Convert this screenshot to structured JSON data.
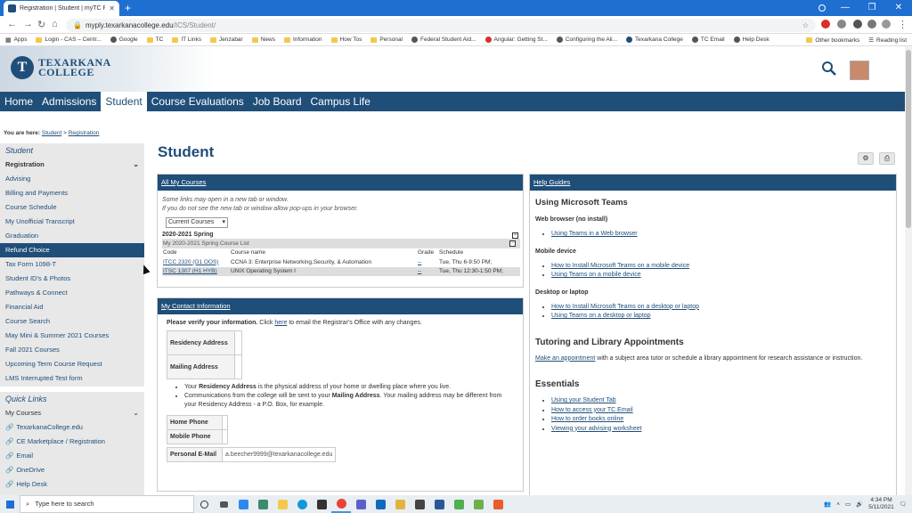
{
  "browser": {
    "tab_title": "Registration | Student | myTC Po",
    "url_host": "myply.texarkanacollege.edu",
    "url_path": "/ICS/Student/",
    "bookmarks": [
      "Apps",
      "Login - CAS – Centr...",
      "Google",
      "TC",
      "IT Links",
      "Jenzabar",
      "News",
      "Information",
      "How Tos",
      "Personal",
      "Federal Student Aid...",
      "Angular: Getting St...",
      "Configuring the Ali...",
      "Texarkana College",
      "TC Email",
      "Help Desk"
    ],
    "bookmarks_right": [
      "Other bookmarks",
      "Reading list"
    ]
  },
  "site": {
    "logo_line1": "TEXARKANA",
    "logo_line2": "COLLEGE",
    "logo_letter": "T"
  },
  "nav": [
    "Home",
    "Admissions",
    "Student",
    "Course Evaluations",
    "Job Board",
    "Campus Life"
  ],
  "breadcrumb": {
    "label": "You are here:",
    "crumbs": [
      "Student",
      "Registration"
    ],
    "separator": ">"
  },
  "sidebar": {
    "title": "Student",
    "section": "Registration",
    "items": [
      "Advising",
      "Billing and Payments",
      "Course Schedule",
      "My Unofficial Transcript",
      "Graduation",
      "Refund Choice",
      "Tax Form 1098-T",
      "Student ID's & Photos",
      "Pathways & Connect",
      "Financial Aid",
      "Course Search",
      "May Mini & Summer 2021 Courses",
      "Fall 2021 Courses",
      "Upcoming Term Course Request",
      "LMS Interrupted Test form"
    ],
    "active_item": "Refund Choice"
  },
  "quick_links": {
    "title": "Quick Links",
    "section": "My Courses",
    "items": [
      "TexarkanaCollege.edu",
      "CE Marketplace / Registration",
      "Email",
      "OneDrive",
      "Help Desk"
    ]
  },
  "main": {
    "title": "Student",
    "courses": {
      "header": "All My Courses",
      "intro1": "Some links may open in a new tab or window.",
      "intro2": "If you do not see the new tab or window allow pop-ups in your browser.",
      "select": "Current Courses",
      "term": "2020-2021 Spring",
      "list_title": "My 2020-2021 Spring Course List",
      "columns": [
        "Code",
        "Course name",
        "Grade",
        "Schedule"
      ],
      "rows": [
        {
          "code": "ITCC 2320 (O1 OOS)",
          "name": "CCNA 3: Enterprise Networking,Security, & Automation",
          "grade": "--",
          "schedule": "Tue, Thu 6-9:50 PM;"
        },
        {
          "code": "ITSC 1307 (H1 HYB)",
          "name": "UNIX Operating System I",
          "grade": "--",
          "schedule": "Tue, Thu 12:30-1:50 PM;"
        }
      ]
    },
    "contact": {
      "header": "My Contact Information",
      "verify_bold": "Please verify your information.",
      "verify_mid": " Click ",
      "verify_link": "here",
      "verify_end": " to email the Registrar's Office with any changes.",
      "residency_label": "Residency Address",
      "mailing_label": "Mailing Address",
      "bullet1_a": "Your ",
      "bullet1_b": "Residency Address",
      "bullet1_c": " is the physical address of your home or dwelling place where you live.",
      "bullet2_a": "Communications from the college will be sent to your ",
      "bullet2_b": "Mailing Address",
      "bullet2_c": ". Your mailing address may be different from your Residency Address - a P.O. Box, for example.",
      "home_phone": "Home Phone",
      "mobile_phone": "Mobile Phone",
      "email_label": "Personal E-Mail",
      "email_value": "a.beecher9999@texarkanacollege.edu"
    },
    "help": {
      "header": "Help Guides",
      "teams_title": "Using Microsoft Teams",
      "web_label": "Web browser (no install)",
      "web_links": [
        "Using Teams in a Web browser"
      ],
      "mobile_label": "Mobile device",
      "mobile_links": [
        "How to Install Microsoft Teams on a mobile device",
        "Using Teams on a mobile device"
      ],
      "desktop_label": "Desktop or laptop",
      "desktop_links": [
        "How to Install Microsoft Teams on a desktop or laptop",
        "Using Teams on a desktop or laptop"
      ],
      "tutoring_title": "Tutoring and Library Appointments",
      "tutoring_link": "Make an appointment",
      "tutoring_text": " with a subject area tutor or schedule a library appointment for research assistance or instruction.",
      "essentials_title": "Essentials",
      "essentials_links": [
        "Using your Student Tab",
        "How to access your TC Email",
        "How to order books online",
        "Viewing your advising worksheet"
      ]
    }
  },
  "taskbar": {
    "search_placeholder": "Type here to search",
    "time": "4:34 PM",
    "date": "5/11/2021"
  }
}
